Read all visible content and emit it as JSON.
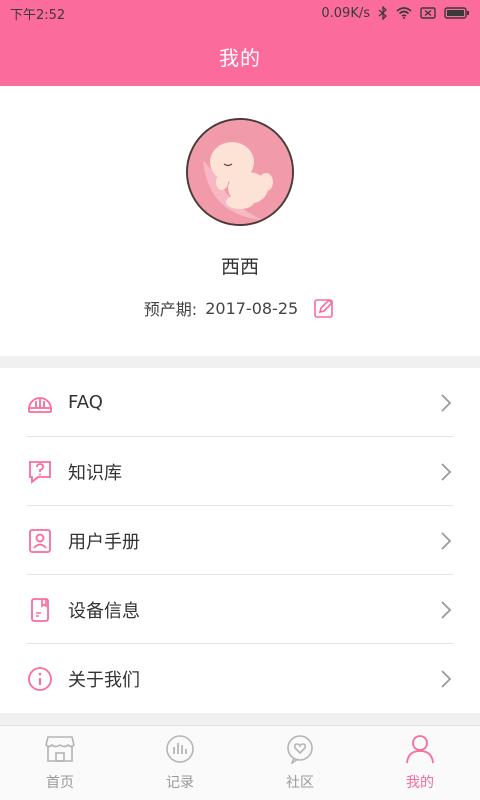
{
  "status_bar": {
    "time": "下午2:52",
    "network_speed": "0.09K/s",
    "bluetooth_icon": "bluetooth-icon",
    "wifi_icon": "wifi-icon",
    "sim_icon": "no-sim-icon",
    "battery_icon": "battery-icon"
  },
  "header": {
    "title": "我的",
    "bg_color": "#fb6b9b"
  },
  "profile": {
    "name": "西西",
    "due_label": "预产期:",
    "due_date": "2017-08-25",
    "edit_icon": "edit-icon"
  },
  "menu": {
    "items": [
      {
        "label": "FAQ",
        "icon": "faq-icon"
      },
      {
        "label": "知识库",
        "icon": "knowledge-icon"
      },
      {
        "label": "用户手册",
        "icon": "user-manual-icon"
      },
      {
        "label": "设备信息",
        "icon": "device-info-icon"
      },
      {
        "label": "关于我们",
        "icon": "about-icon"
      }
    ]
  },
  "tabs": [
    {
      "label": "首页",
      "icon": "home-icon",
      "active": false
    },
    {
      "label": "记录",
      "icon": "record-icon",
      "active": false
    },
    {
      "label": "社区",
      "icon": "community-icon",
      "active": false
    },
    {
      "label": "我的",
      "icon": "profile-icon",
      "active": true
    }
  ],
  "colors": {
    "accent": "#fb6b9b",
    "inactive": "#9a9a9a"
  }
}
